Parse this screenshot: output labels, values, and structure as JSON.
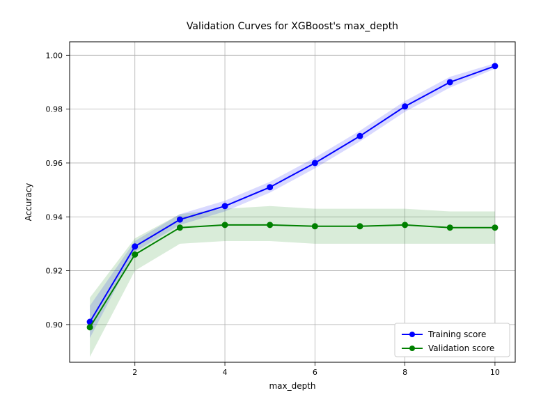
{
  "chart_data": {
    "type": "line",
    "title": "Validation Curves for XGBoost's max_depth",
    "xlabel": "max_depth",
    "ylabel": "Accuracy",
    "x": [
      1,
      2,
      3,
      4,
      5,
      6,
      7,
      8,
      9,
      10
    ],
    "xlim": [
      0.55,
      10.45
    ],
    "ylim": [
      0.886,
      1.005
    ],
    "xticks": [
      2,
      4,
      6,
      8,
      10
    ],
    "yticks": [
      0.9,
      0.92,
      0.94,
      0.96,
      0.98,
      1.0
    ],
    "series": [
      {
        "name": "Training score",
        "color": "#0000ff",
        "values": [
          0.901,
          0.929,
          0.939,
          0.944,
          0.951,
          0.96,
          0.97,
          0.981,
          0.99,
          0.996
        ],
        "band_lower": [
          0.895,
          0.927,
          0.937,
          0.942,
          0.949,
          0.958,
          0.968,
          0.979,
          0.988,
          0.995
        ],
        "band_upper": [
          0.907,
          0.931,
          0.941,
          0.946,
          0.953,
          0.962,
          0.972,
          0.983,
          0.992,
          0.997
        ]
      },
      {
        "name": "Validation score",
        "color": "#008000",
        "values": [
          0.899,
          0.926,
          0.936,
          0.937,
          0.937,
          0.9365,
          0.9365,
          0.937,
          0.936,
          0.936
        ],
        "band_lower": [
          0.888,
          0.92,
          0.93,
          0.931,
          0.931,
          0.93,
          0.93,
          0.93,
          0.93,
          0.93
        ],
        "band_upper": [
          0.91,
          0.932,
          0.941,
          0.943,
          0.944,
          0.943,
          0.943,
          0.943,
          0.942,
          0.942
        ]
      }
    ],
    "legend": {
      "position": "lower right",
      "items": [
        "Training score",
        "Validation score"
      ]
    }
  }
}
